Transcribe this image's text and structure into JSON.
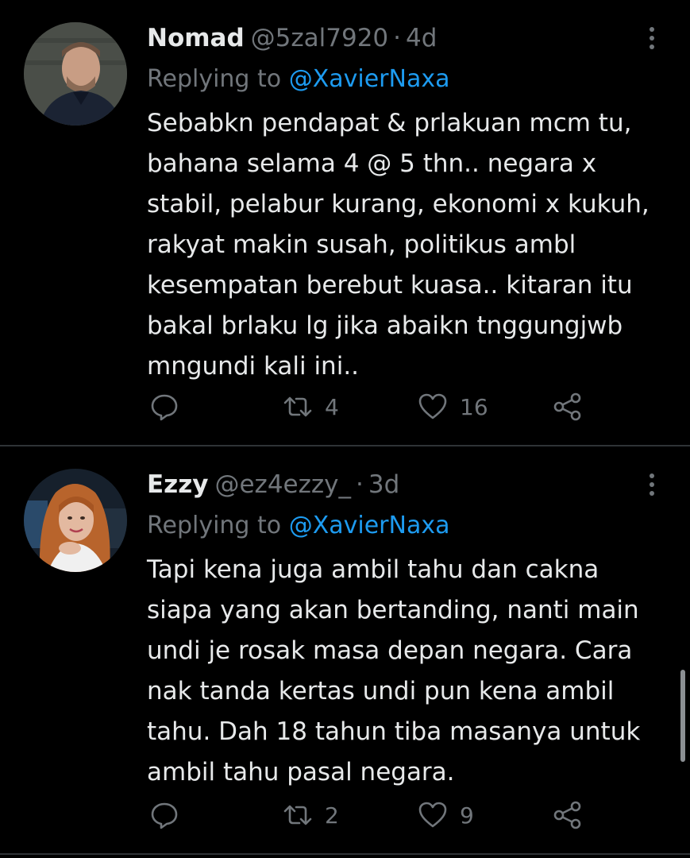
{
  "tweets": [
    {
      "name": "Nomad",
      "handle": "@5zal7920",
      "separator": "·",
      "time": "4d",
      "replying_prefix": "Replying to",
      "replying_to": "@XavierNaxa",
      "lines": [
        "Sebabkn pendapat & prlakuan mcm tu,",
        "bahana selama 4 @ 5 thn.. negara x",
        "stabil, pelabur kurang, ekonomi x kukuh,",
        "rakyat makin susah, politikus ambl",
        "kesempatan berebut kuasa.. kitaran itu",
        "bakal brlaku lg jika abaikn tnggungjwb",
        "mngundi kali ini.."
      ],
      "retweets": "4",
      "likes": "16"
    },
    {
      "name": "Ezzy",
      "handle": "@ez4ezzy_",
      "separator": "·",
      "time": "3d",
      "replying_prefix": "Replying to",
      "replying_to": "@XavierNaxa",
      "lines": [
        "Tapi kena juga ambil tahu dan cakna",
        "siapa yang akan bertanding, nanti main",
        "undi je rosak masa depan negara. Cara",
        "nak tanda kertas undi pun kena ambil",
        "tahu. Dah 18 tahun tiba masanya untuk",
        "ambil tahu pasal negara."
      ],
      "retweets": "2",
      "likes": "9"
    }
  ],
  "icons": {
    "reply": "reply-icon",
    "retweet": "retweet-icon",
    "like": "heart-icon",
    "share": "share-icon",
    "more": "more-icon"
  },
  "colors": {
    "background": "#000000",
    "text": "#e7e9ea",
    "muted": "#71767b",
    "link": "#1d9bf0",
    "divider": "#2f3336"
  }
}
